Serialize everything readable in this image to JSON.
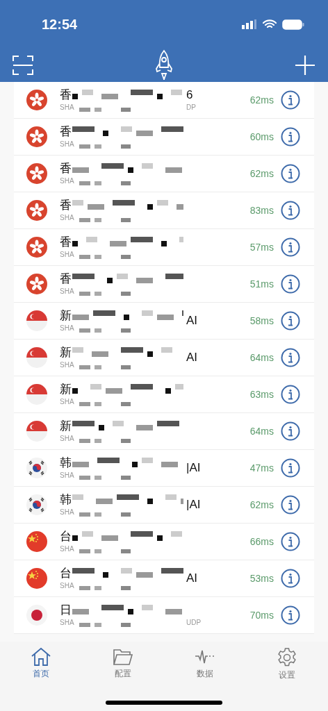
{
  "status_bar": {
    "time": "12:54"
  },
  "servers": [
    {
      "kind": "hk",
      "name": "香",
      "name_tail": "6",
      "sub": "SHA",
      "sub_tail": "DP",
      "latency": "62ms"
    },
    {
      "kind": "hk",
      "name": "香",
      "sub": "SHA",
      "latency": "60ms"
    },
    {
      "kind": "hk",
      "name": "香",
      "sub": "SHA",
      "latency": "62ms"
    },
    {
      "kind": "hk",
      "name": "香",
      "sub": "SHA",
      "latency": "83ms"
    },
    {
      "kind": "hk",
      "name": "香",
      "sub": "SHA",
      "latency": "57ms"
    },
    {
      "kind": "hk",
      "name": "香",
      "sub": "SHA",
      "latency": "51ms"
    },
    {
      "kind": "sg",
      "name": "新",
      "name_tail": "AI",
      "sub": "SHA",
      "latency": "58ms"
    },
    {
      "kind": "sg",
      "name": "新",
      "name_tail": "AI",
      "sub": "SHA",
      "latency": "64ms"
    },
    {
      "kind": "sg",
      "name": "新",
      "sub": "SHA",
      "latency": "63ms"
    },
    {
      "kind": "sg",
      "name": "新",
      "sub": "SHA",
      "latency": "64ms"
    },
    {
      "kind": "kr",
      "name": "韩",
      "name_tail": "|AI",
      "sub": "SHA",
      "latency": "47ms"
    },
    {
      "kind": "kr",
      "name": "韩",
      "name_tail": "|AI",
      "sub": "SHA",
      "latency": "62ms"
    },
    {
      "kind": "cn",
      "name": "台",
      "sub": "SHA",
      "latency": "66ms"
    },
    {
      "kind": "cn",
      "name": "台",
      "name_tail": "AI",
      "sub": "SHA",
      "latency": "53ms"
    },
    {
      "kind": "jp",
      "name": "日",
      "sub": "SHA",
      "sub_tail": "UDP",
      "latency": "70ms"
    }
  ],
  "tabs": [
    {
      "label": "首页",
      "kind": "home",
      "selected": true
    },
    {
      "label": "配置",
      "kind": "folder",
      "selected": false
    },
    {
      "label": "数据",
      "kind": "pulse",
      "selected": false
    },
    {
      "label": "设置",
      "kind": "gear",
      "selected": false
    }
  ]
}
